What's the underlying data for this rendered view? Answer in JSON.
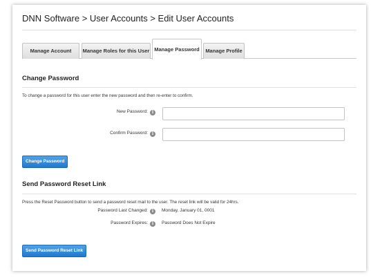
{
  "page": {
    "title": "DNN Software > User Accounts > Edit User Accounts"
  },
  "tabs": [
    {
      "label": "Manage Account"
    },
    {
      "label": "Manage Roles for this User"
    },
    {
      "label": "Manage Password",
      "active": true
    },
    {
      "label": "Manage Profile"
    }
  ],
  "change_password": {
    "heading": "Change Password",
    "description": "To change a password for this user enter the new password and then re-enter to confirm.",
    "new_password_label": "New Password:",
    "new_password_value": "",
    "confirm_password_label": "Confirm Password:",
    "confirm_password_value": "",
    "button_label": "Change Password"
  },
  "reset_link": {
    "heading": "Send Password Reset Link",
    "description": "Press the Reset Password button to send a password reset mail to the user. The reset link will be valid for 24hrs.",
    "last_changed_label": "Password Last Changed:",
    "last_changed_value": "Monday, January 01, 0001",
    "expires_label": "Password Expires:",
    "expires_value": "Password Does Not Expire",
    "button_label": "Send Password Reset Link"
  },
  "icons": {
    "info": "info-icon"
  },
  "colors": {
    "button_primary": "#1f78cf",
    "info_icon": "#8a8a8a"
  }
}
